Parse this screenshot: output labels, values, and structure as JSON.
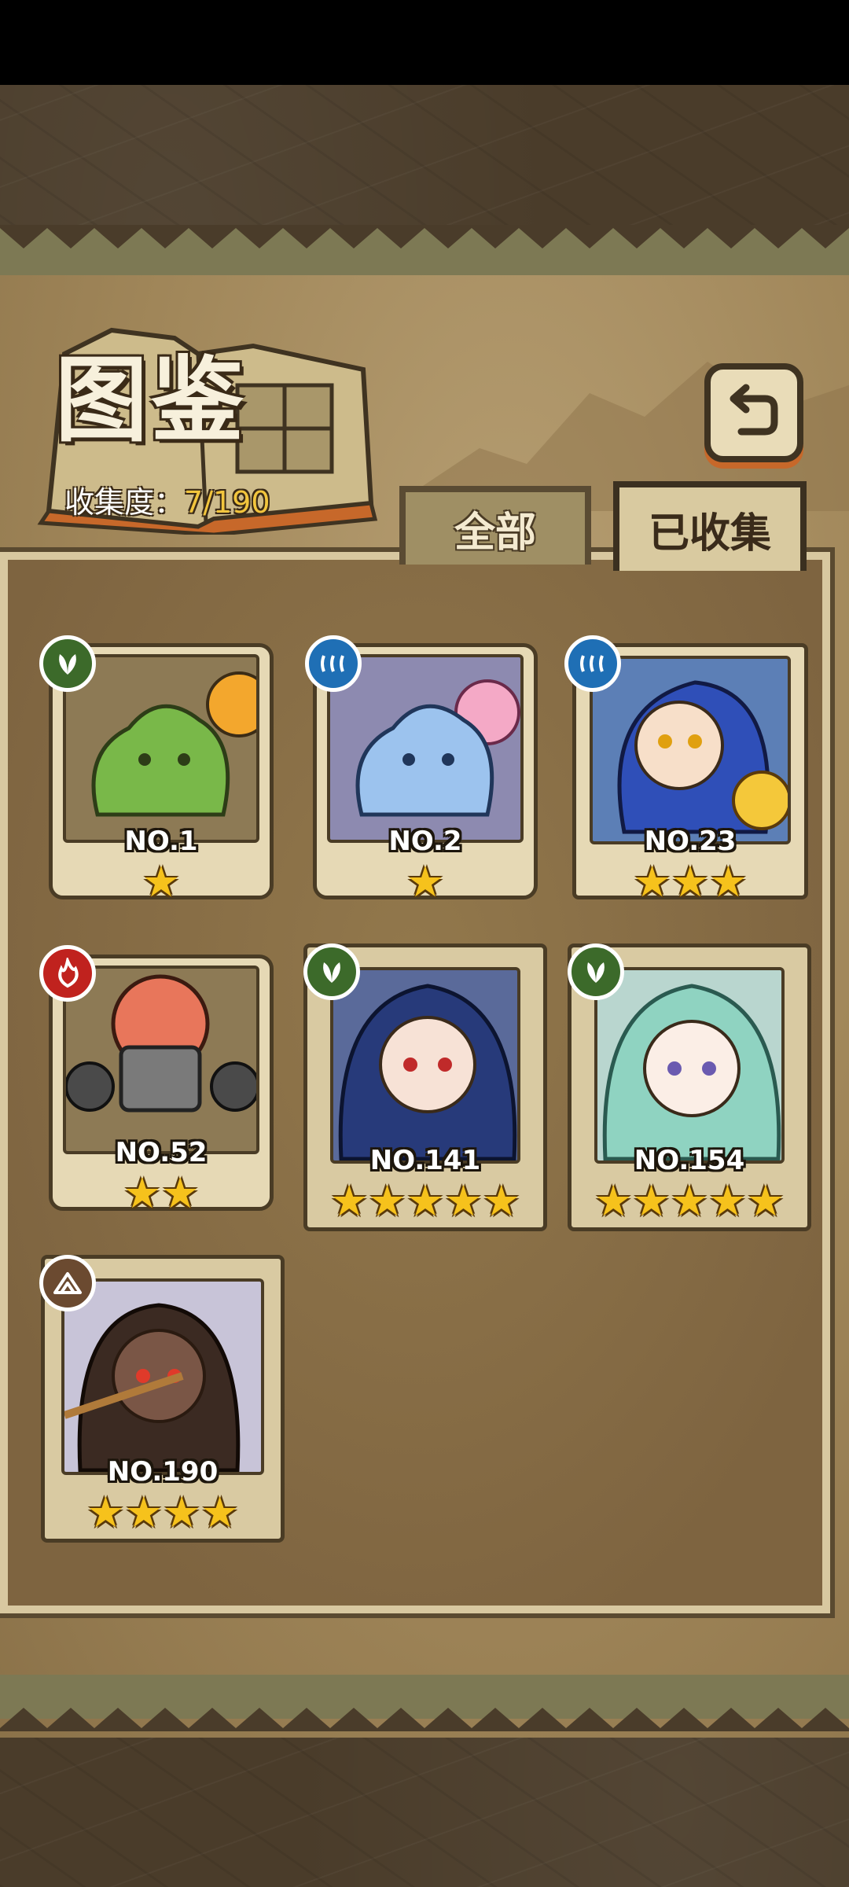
{
  "header": {
    "title": "图鉴",
    "collection_label": "收集度：",
    "collection_value": "7/190"
  },
  "tabs": [
    {
      "label": "全部",
      "active": false
    },
    {
      "label": "已收集",
      "active": true
    }
  ],
  "colors": {
    "grass": "#3c6a2a",
    "water": "#1f6fb5",
    "fire": "#c0221e",
    "earth": "#6b4a30",
    "star": "#f6c21c"
  },
  "cards": [
    {
      "number": "NO.1",
      "stars": 1,
      "element": "leaf-icon"
    },
    {
      "number": "NO.2",
      "stars": 1,
      "element": "water-icon"
    },
    {
      "number": "NO.23",
      "stars": 3,
      "element": "water-icon"
    },
    {
      "number": "NO.52",
      "stars": 2,
      "element": "fire-icon"
    },
    {
      "number": "NO.141",
      "stars": 5,
      "element": "leaf-icon"
    },
    {
      "number": "NO.154",
      "stars": 5,
      "element": "leaf-icon"
    },
    {
      "number": "NO.190",
      "stars": 4,
      "element": "mountain-icon"
    }
  ]
}
